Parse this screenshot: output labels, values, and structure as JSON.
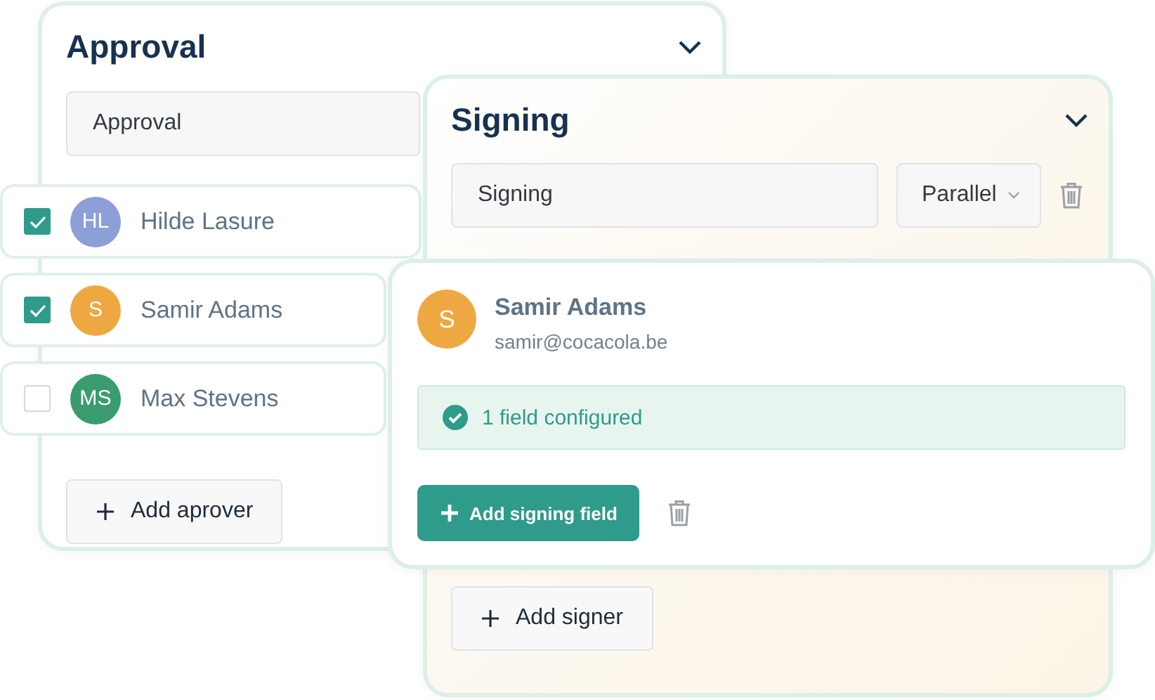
{
  "approval": {
    "title": "Approval",
    "name_value": "Approval",
    "add_button": "Add aprover",
    "approvers": [
      {
        "initials": "HL",
        "name": "Hilde Lasure",
        "color": "#8c9fd6",
        "checked": true
      },
      {
        "initials": "S",
        "name": "Samir Adams",
        "color": "#eea842",
        "checked": true
      },
      {
        "initials": "MS",
        "name": "Max Stevens",
        "color": "#3a9b6f",
        "checked": false
      }
    ]
  },
  "signing": {
    "title": "Signing",
    "name_value": "Signing",
    "mode": "Parallel",
    "add_button": "Add signer"
  },
  "signer": {
    "initials": "S",
    "name": "Samir Adams",
    "email": "samir@cocacola.be",
    "color": "#eea842",
    "status": "1 field configured",
    "add_button": "Add signing field"
  }
}
